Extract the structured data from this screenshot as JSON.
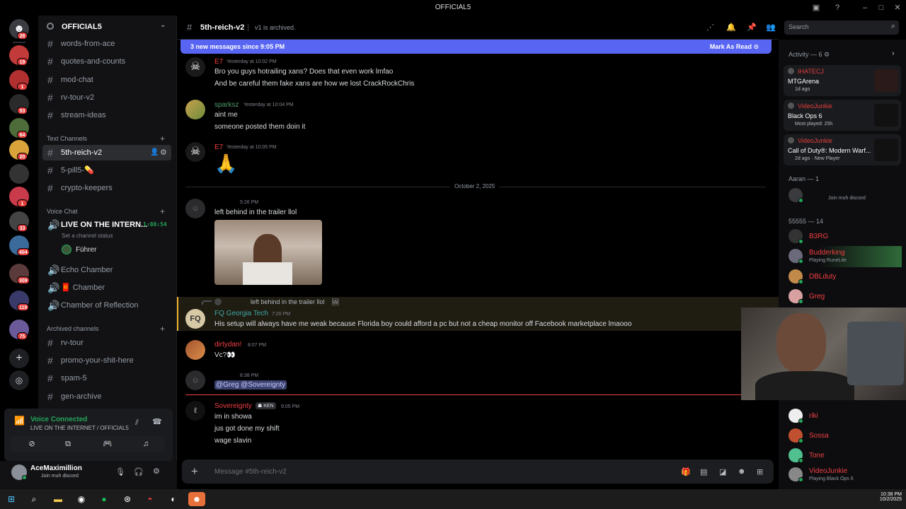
{
  "window": {
    "title": "OFFICIAL5"
  },
  "guilds": [
    {
      "name": "Direct messages",
      "badge": "28"
    },
    {
      "name": "server-2",
      "badge": "19"
    },
    {
      "name": "server-3",
      "badge": "1"
    },
    {
      "name": "server-4",
      "badge": "53"
    },
    {
      "name": "server-5",
      "badge": "64"
    },
    {
      "name": "server-6",
      "badge": "20"
    },
    {
      "name": "server-7",
      "badge": ""
    },
    {
      "name": "server-8",
      "badge": "1"
    },
    {
      "name": "server-9",
      "badge": "33"
    },
    {
      "name": "server-10",
      "badge": "404"
    },
    {
      "name": "server-11",
      "badge": "309"
    },
    {
      "name": "server-12",
      "badge": "119"
    },
    {
      "name": "server-13",
      "badge": "75"
    }
  ],
  "sidebar": {
    "server_name": "OFFICIAL5",
    "top_channels": [
      "words-from-ace",
      "quotes-and-counts",
      "mod-chat",
      "rv-tour-v2",
      "stream-ideas"
    ],
    "text_category": "Text Channels",
    "text_channels": [
      "5th-reich-v2",
      "5-pill5-💊",
      "crypto-keepers"
    ],
    "voice_category": "Voice Chat",
    "voice_live": {
      "name": "LIVE ON THE INTERN...",
      "timer": "1:08:54",
      "status": "Set a channel status",
      "user": "Führer"
    },
    "voice_channels": [
      "Echo Chamber",
      "🧧 Chamber",
      "Chamber of Reflection"
    ],
    "archived_category": "Archived channels",
    "archived_channels": [
      "rv-tour",
      "promo-your-shit-here",
      "spam-5",
      "gen-archive"
    ],
    "voice_connected": {
      "label": "Voice Connected",
      "location": "LIVE ON THE INTERNET / OFFICIAL5"
    },
    "user": {
      "name": "AceMaximillion",
      "status": "Join muh discord"
    }
  },
  "header": {
    "channel": "5th-reich-v2",
    "topic": "v1 is archived.",
    "search_placeholder": "Search"
  },
  "banner": {
    "text": "3 new messages since 9:05 PM",
    "action": "Mark As Read"
  },
  "messages": [
    {
      "author": "E7",
      "color": "#f23f43",
      "time": "Yesterday at 10:02 PM",
      "lines": [
        "Bro you guys hotrailing xans? Does that even work lmfao",
        "And be careful them fake xans are how we lost CrackRockChris"
      ]
    },
    {
      "author": "sparksz",
      "color": "#4e9a6a",
      "time": "Yesterday at 10:04 PM",
      "lines": [
        "aint me",
        "someone posted them doin it"
      ]
    },
    {
      "author": "E7",
      "color": "#f23f43",
      "time": "Yesterday at 10:05 PM",
      "lines": [
        "🙏"
      ]
    },
    {
      "divider": "October 2, 2025"
    },
    {
      "author": "",
      "time": "5:26 PM",
      "lines": [
        "left behind in the trailer llol"
      ]
    },
    {
      "reply": "left behind in the trailer llol",
      "author": "FQ Georgia Tech",
      "color": "#3fa7a3",
      "time": "7:20 PM",
      "lines": [
        "His setup will always have me weak because Florida boy could afford a pc but not a cheap monitor off Facebook marketplace lmaooo"
      ]
    },
    {
      "author": "dirtydan!",
      "color": "#f23f43",
      "time": "8:07 PM",
      "lines": [
        "Vc?👀"
      ]
    },
    {
      "author": "",
      "time": "8:38 PM",
      "lines": [
        "@Greg @Sovereignty"
      ]
    },
    {
      "author": "Sovereignty",
      "color": "#f23f43",
      "tag": "KEN",
      "time": "9:05 PM",
      "lines": [
        "im in showa",
        "jus got done my shift",
        "wage slavin"
      ]
    }
  ],
  "composer": {
    "placeholder": "Message #5th-reich-v2"
  },
  "members": {
    "activity_header": "Activity — 6",
    "activities": [
      {
        "user": "IHATECJ",
        "game": "MTGArena",
        "detail": "1d ago"
      },
      {
        "user": "VideoJunkie",
        "game": "Black Ops 6",
        "detail": "Most played: 25h"
      },
      {
        "user": "VideoJunkie",
        "game": "Call of Duty®: Modern Warf...",
        "detail": "2d ago · New Player"
      }
    ],
    "group1_header": "Aaran — 1",
    "group1": [
      {
        "name": "",
        "status": "Join muh discord"
      }
    ],
    "group2_header": "55555 — 14",
    "group2": [
      {
        "name": "B3RG",
        "status": "",
        "color": "#f23f43"
      },
      {
        "name": "Budderking",
        "status": "Playing RuneLite",
        "color": "#f23f43"
      },
      {
        "name": "DBLduty",
        "status": "",
        "color": "#f23f43"
      },
      {
        "name": "Greg",
        "status": "",
        "color": "#f23f43"
      },
      {
        "name": "riki",
        "status": "",
        "color": "#f23f43"
      },
      {
        "name": "Sossa",
        "status": "",
        "color": "#f23f43"
      },
      {
        "name": "Tone",
        "status": "",
        "color": "#f23f43"
      },
      {
        "name": "VideoJunkie",
        "status": "Playing Black Ops 6",
        "color": "#f23f43"
      }
    ]
  },
  "taskbar": {
    "time": "10:38 PM",
    "date": "10/2/2025"
  },
  "colors": {
    "accent": "#5865f2",
    "online": "#23a55a",
    "danger": "#f23f43"
  }
}
